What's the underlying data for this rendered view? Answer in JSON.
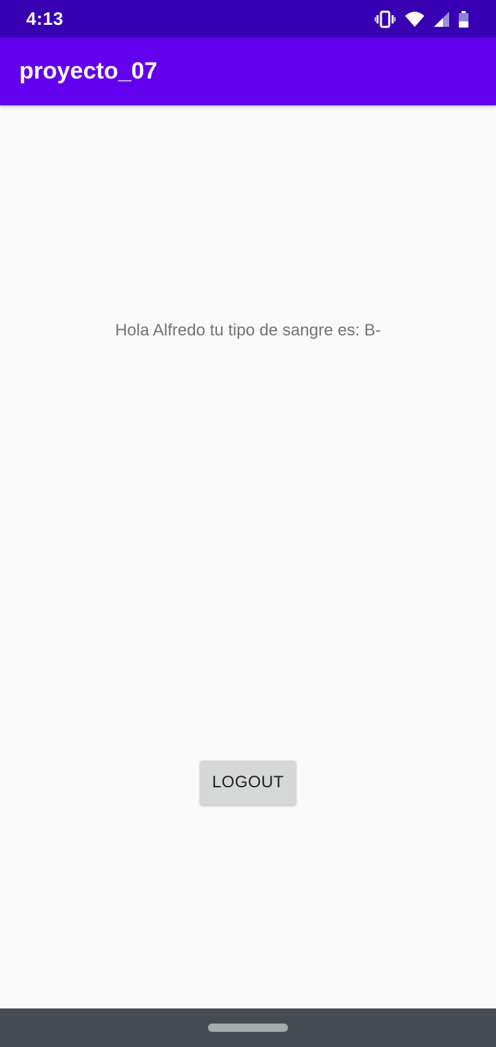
{
  "status_bar": {
    "time": "4:13",
    "icons": [
      "vibrate-icon",
      "wifi-icon",
      "signal-icon",
      "battery-icon"
    ],
    "background_color": "#3700b3"
  },
  "app_bar": {
    "title": "proyecto_07",
    "background_color": "#6200ee"
  },
  "content": {
    "greeting": "Hola Alfredo tu tipo de sangre es: B-",
    "logout_label": "LOGOUT"
  },
  "nav_bar": {
    "background_color": "#464c54",
    "home_handle": "home-gesture-handle"
  }
}
